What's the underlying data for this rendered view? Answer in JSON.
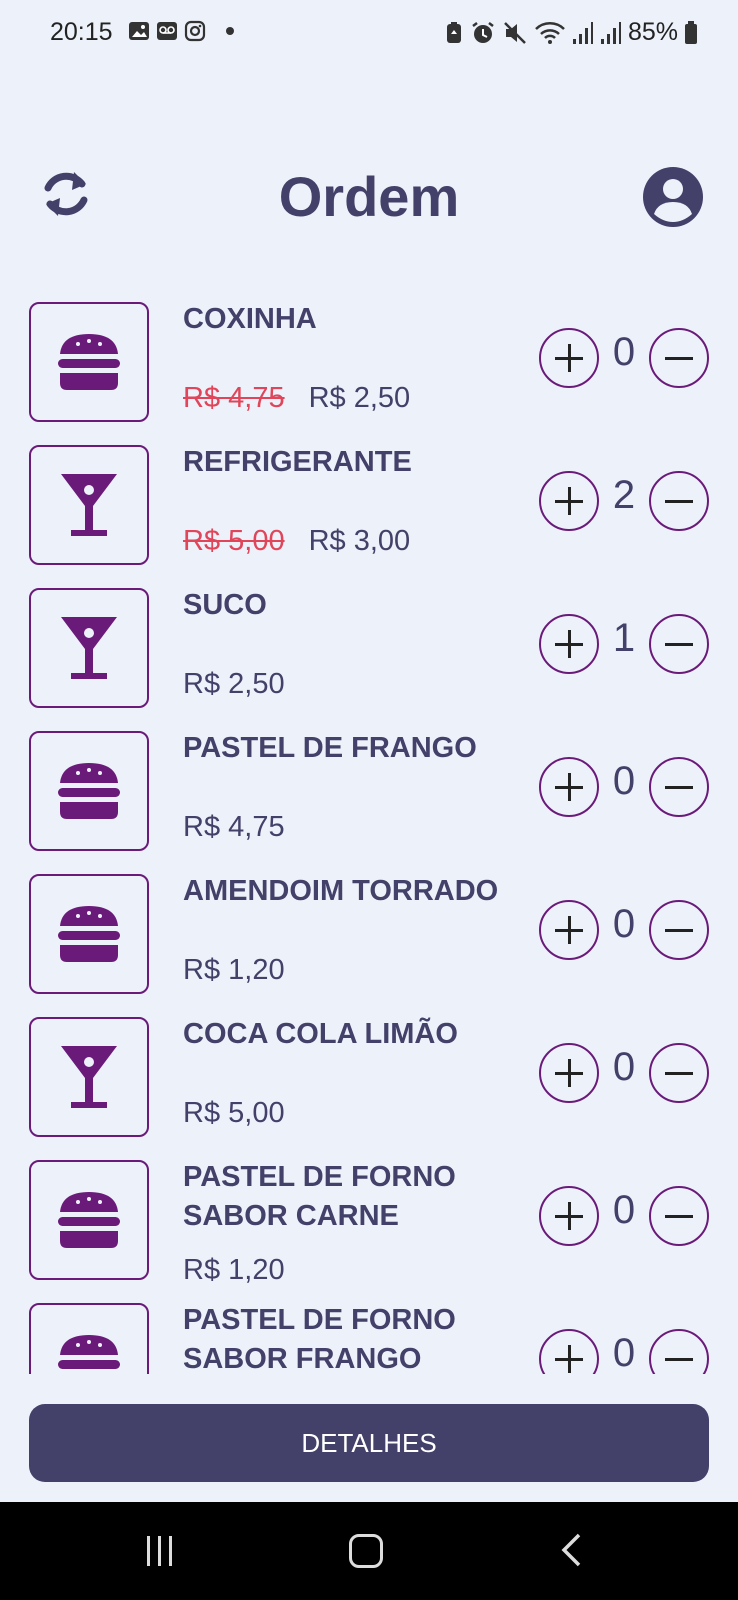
{
  "status_bar": {
    "time": "20:15",
    "battery": "85%",
    "left_icons": [
      "image-icon",
      "voicemail-icon",
      "instagram-icon",
      "dot-icon"
    ],
    "right_icons": [
      "battery-saver-icon",
      "alarm-icon",
      "mute-icon",
      "wifi-icon",
      "signal-icon",
      "signal-icon",
      "battery-icon"
    ]
  },
  "header": {
    "title": "Ordem",
    "left_icon": "refresh-icon",
    "right_icon": "account-circle-icon"
  },
  "colors": {
    "background": "#EDF1F9",
    "primary_text": "#434069",
    "accent_purple": "#6A1B7A",
    "discount_red": "#E0455A",
    "button_bg": "#434069"
  },
  "items": [
    {
      "name": "COXINHA",
      "old_price": "R$ 4,75",
      "price": "R$ 2,50",
      "qty": "0",
      "icon": "burger-icon"
    },
    {
      "name": "REFRIGERANTE",
      "old_price": "R$ 5,00",
      "price": "R$ 3,00",
      "qty": "2",
      "icon": "cocktail-icon"
    },
    {
      "name": "SUCO",
      "old_price": "",
      "price": "R$ 2,50",
      "qty": "1",
      "icon": "cocktail-icon"
    },
    {
      "name": "PASTEL DE FRANGO",
      "old_price": "",
      "price": "R$ 4,75",
      "qty": "0",
      "icon": "burger-icon"
    },
    {
      "name": "AMENDOIM TORRADO",
      "old_price": "",
      "price": "R$ 1,20",
      "qty": "0",
      "icon": "burger-icon"
    },
    {
      "name": "COCA COLA LIMÃO",
      "old_price": "",
      "price": "R$ 5,00",
      "qty": "0",
      "icon": "cocktail-icon"
    },
    {
      "name": "PASTEL DE FORNO SABOR CARNE",
      "old_price": "",
      "price": "R$ 1,20",
      "qty": "0",
      "icon": "burger-icon"
    },
    {
      "name": "PASTEL DE FORNO SABOR FRANGO",
      "old_price": "",
      "price": "",
      "qty": "0",
      "icon": "burger-icon"
    }
  ],
  "footer": {
    "details_label": "DETALHES"
  },
  "nav_bar": {
    "buttons": [
      "recents-icon",
      "home-icon",
      "back-icon"
    ]
  }
}
